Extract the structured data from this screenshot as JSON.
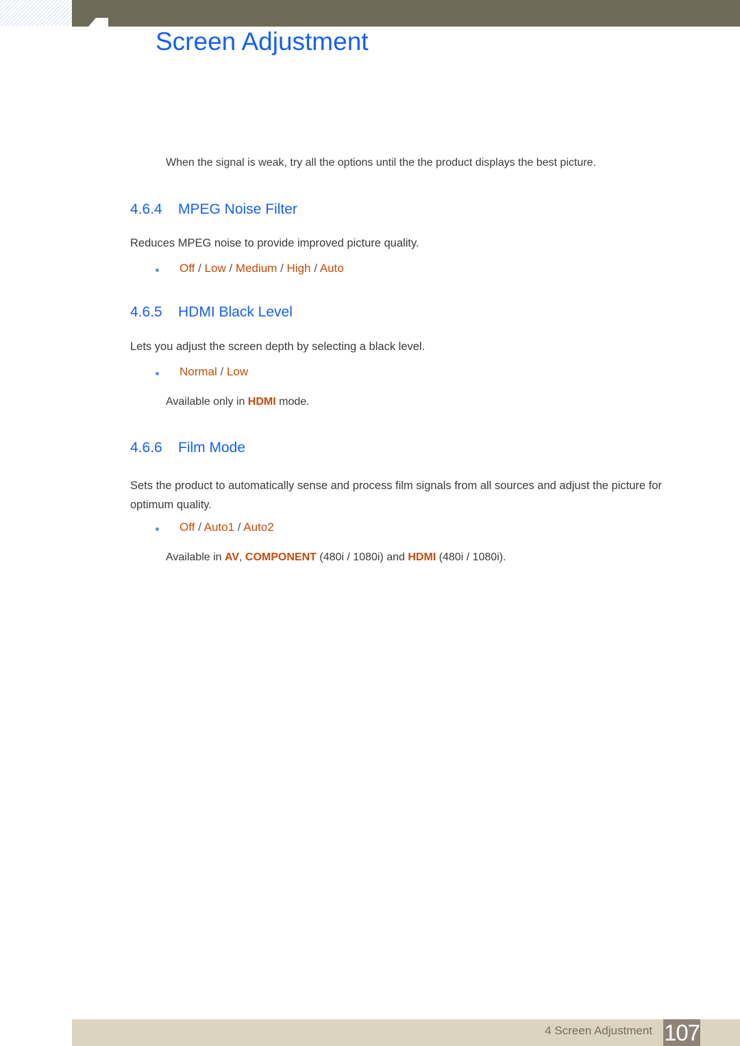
{
  "header": {
    "title": "Screen Adjustment"
  },
  "intro_note": "When the signal is weak, try all the options until the the product displays the best picture.",
  "sections": [
    {
      "number": "4.6.4",
      "title": "MPEG Noise Filter",
      "description": "Reduces MPEG noise to provide improved picture quality.",
      "options": [
        "Off",
        "Low",
        "Medium",
        "High",
        "Auto"
      ]
    },
    {
      "number": "4.6.5",
      "title": "HDMI Black Level",
      "description": "Lets you adjust the screen depth by selecting a black level.",
      "options": [
        "Normal",
        "Low"
      ],
      "note": {
        "pre": "Available only in ",
        "hl": "HDMI",
        "post": " mode."
      }
    },
    {
      "number": "4.6.6",
      "title": "Film Mode",
      "description": "Sets the product to automatically sense and process film signals from all sources and adjust the picture for optimum quality.",
      "options": [
        "Off",
        "Auto1",
        "Auto2"
      ],
      "note": {
        "pre": "Available in ",
        "hl1": "AV",
        "sep": ", ",
        "hl2": "COMPONENT",
        "mid": " (480i / 1080i) and ",
        "hl3": "HDMI",
        "post": " (480i / 1080i)."
      }
    }
  ],
  "separator": " / ",
  "footer": {
    "chapter": "4 Screen Adjustment",
    "page": "107"
  },
  "colors": {
    "header_bar": "#6d6b58",
    "heading_blue": "#1660f0",
    "option_orange": "#c84a0a",
    "footer_bar": "#dbd5bf"
  }
}
